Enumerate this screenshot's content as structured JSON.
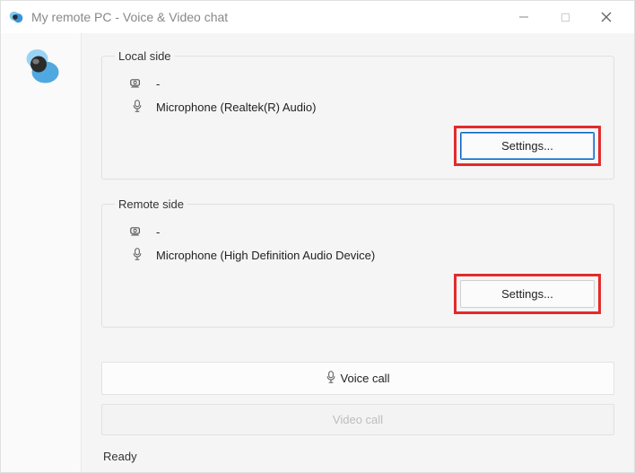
{
  "window": {
    "title": "My remote PC - Voice & Video chat"
  },
  "local_side": {
    "legend": "Local side",
    "camera_label": "-",
    "mic_label": "Microphone (Realtek(R) Audio)",
    "settings_label": "Settings..."
  },
  "remote_side": {
    "legend": "Remote side",
    "camera_label": "-",
    "mic_label": "Microphone (High Definition Audio Device)",
    "settings_label": "Settings..."
  },
  "actions": {
    "voice_call_label": "Voice call",
    "video_call_label": "Video call"
  },
  "status": {
    "text": "Ready"
  }
}
